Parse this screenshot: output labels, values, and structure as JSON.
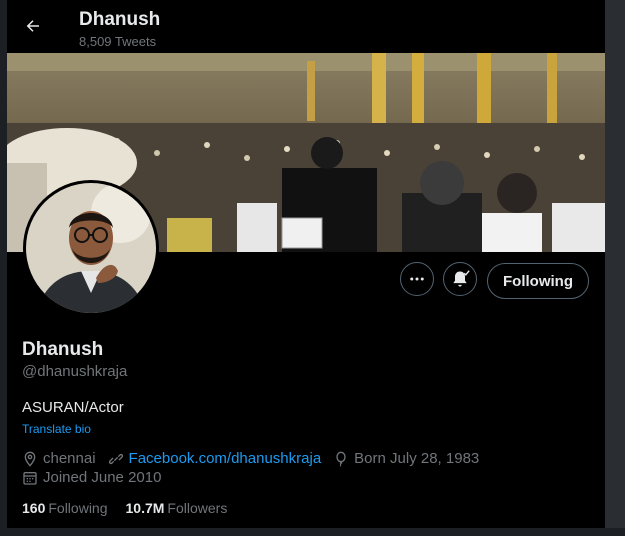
{
  "header": {
    "title": "Dhanush",
    "tweet_count": "8,509 Tweets"
  },
  "icons": {
    "back": "arrow-left-icon",
    "more": "more-dots-icon",
    "notify": "bell-check-icon",
    "location": "location-pin-icon",
    "link": "link-icon",
    "birthday": "balloon-icon",
    "joined": "calendar-icon"
  },
  "actions": {
    "following_label": "Following"
  },
  "profile": {
    "name": "Dhanush",
    "handle": "@dhanushkraja",
    "bio": "ASURAN/Actor",
    "translate_label": "Translate bio",
    "location": "chennai",
    "website": "Facebook.com/dhanushkraja",
    "born": "Born July 28, 1983",
    "joined": "Joined June 2010"
  },
  "stats": {
    "following_count": "160",
    "following_label": "Following",
    "followers_count": "10.7M",
    "followers_label": "Followers"
  },
  "colors": {
    "background": "#000000",
    "text_primary": "#e7e9ea",
    "text_secondary": "#71767b",
    "accent": "#1d9bf0",
    "border": "#536471"
  }
}
